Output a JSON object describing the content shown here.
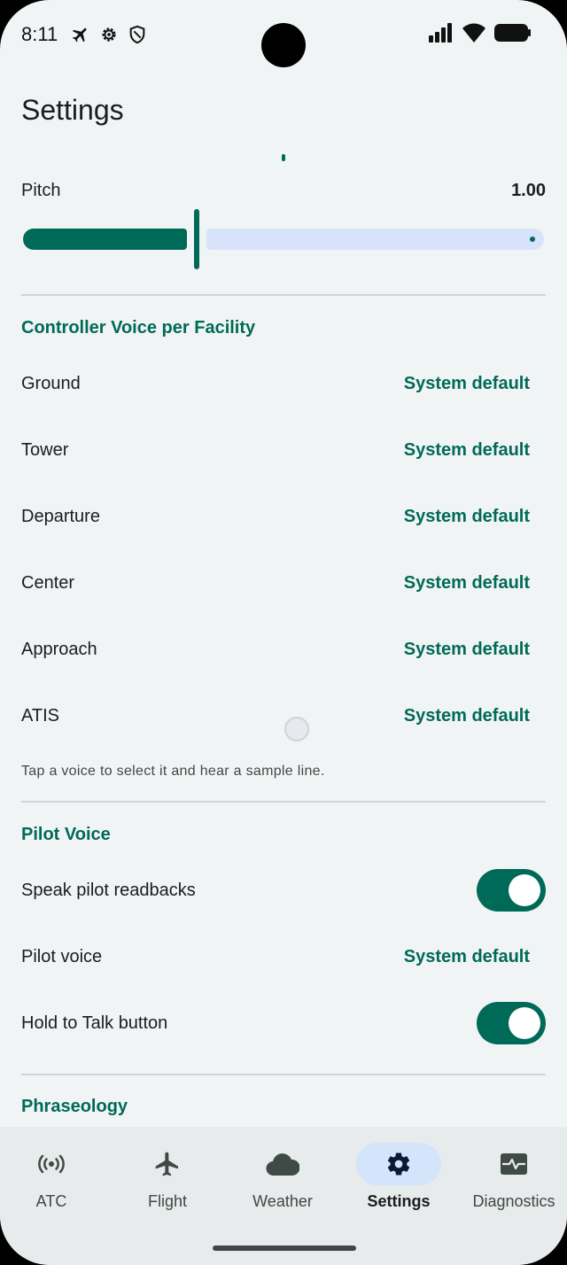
{
  "status_bar": {
    "time": "8:11",
    "left_icons": [
      "airplane-mode-icon",
      "settings-gear-icon",
      "shield-icon"
    ],
    "right_icons": [
      "cell-signal-icon",
      "wifi-icon",
      "battery-icon"
    ]
  },
  "page": {
    "title": "Settings"
  },
  "pitch": {
    "label": "Pitch",
    "value": "1.00",
    "fraction": 0.33
  },
  "controller_voice": {
    "header": "Controller Voice per Facility",
    "rows": [
      {
        "label": "Ground",
        "value": "System default"
      },
      {
        "label": "Tower",
        "value": "System default"
      },
      {
        "label": "Departure",
        "value": "System default"
      },
      {
        "label": "Center",
        "value": "System default"
      },
      {
        "label": "Approach",
        "value": "System default"
      },
      {
        "label": "ATIS",
        "value": "System default"
      }
    ],
    "helper": "Tap a voice to select it and hear a sample line."
  },
  "pilot_voice": {
    "header": "Pilot Voice",
    "speak_readbacks": {
      "label": "Speak pilot readbacks",
      "on": true
    },
    "pilot_voice": {
      "label": "Pilot voice",
      "value": "System default"
    },
    "hold_to_talk": {
      "label": "Hold to Talk button",
      "on": true
    }
  },
  "phraseology": {
    "header": "Phraseology"
  },
  "nav": {
    "items": [
      {
        "label": "ATC",
        "icon": "broadcast-icon",
        "active": false
      },
      {
        "label": "Flight",
        "icon": "airplane-icon",
        "active": false
      },
      {
        "label": "Weather",
        "icon": "cloud-icon",
        "active": false
      },
      {
        "label": "Settings",
        "icon": "settings-gear-icon",
        "active": true
      },
      {
        "label": "Diagnostics",
        "icon": "monitor-heart-icon",
        "active": false
      }
    ]
  },
  "colors": {
    "accent": "#006a58",
    "background": "#f1f4f5",
    "nav_active": "#d3e4fb"
  }
}
